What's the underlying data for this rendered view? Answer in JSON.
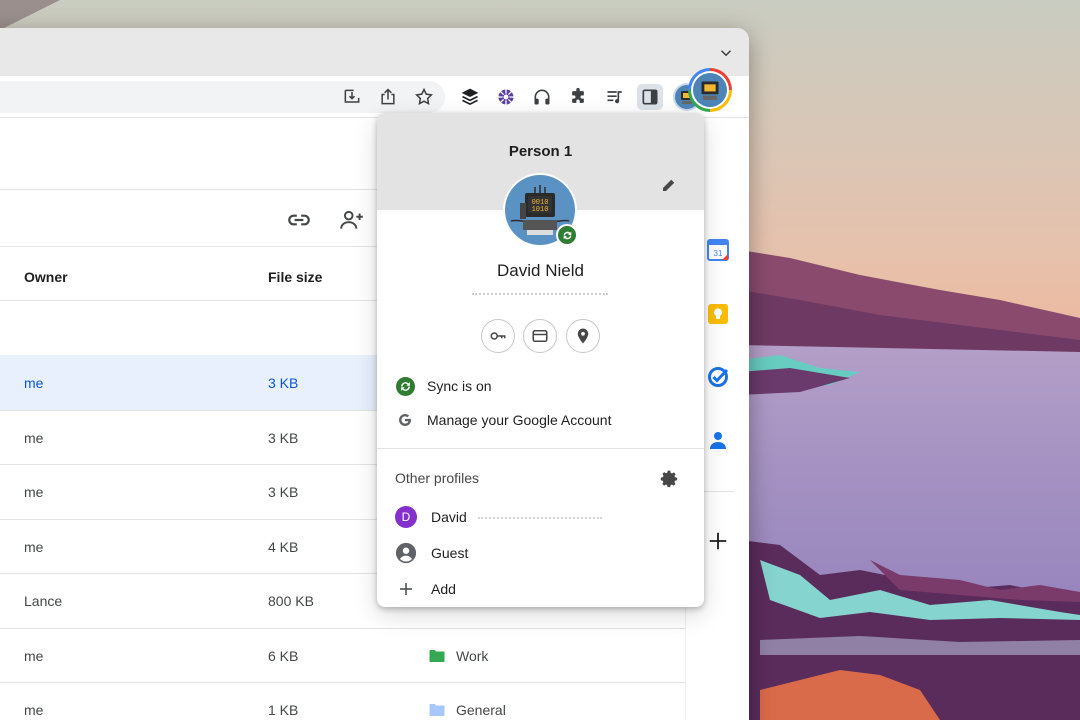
{
  "profile_menu": {
    "title": "Person 1",
    "user_name": "David Nield",
    "sync_label": "Sync is on",
    "manage_label": "Manage your Google Account",
    "other_profiles_label": "Other profiles",
    "profiles": [
      {
        "initial": "D",
        "name": "David"
      },
      {
        "name": "Guest"
      }
    ],
    "add_label": "Add"
  },
  "drive": {
    "columns": {
      "owner": "Owner",
      "file_size": "File size"
    },
    "rows": [
      {
        "owner": "me",
        "size": "3 KB",
        "location": "",
        "selected": true
      },
      {
        "owner": "me",
        "size": "3 KB",
        "location": ""
      },
      {
        "owner": "me",
        "size": "3 KB",
        "location": ""
      },
      {
        "owner": "me",
        "size": "4 KB",
        "location": ""
      },
      {
        "owner": "Lance",
        "size": "800 KB",
        "location": ""
      },
      {
        "owner": "me",
        "size": "6 KB",
        "location": "Work",
        "folder_color": "#34a853"
      },
      {
        "owner": "me",
        "size": "1 KB",
        "location": "General",
        "folder_color": "#a8c7fa"
      }
    ]
  },
  "rail": {
    "calendar_day": "31"
  },
  "colors": {
    "accent": "#0b57d0",
    "selected_row": "#e8f0fe",
    "sync_green": "#2e7d32",
    "menu_header": "#e3e3e3",
    "profile_avatar": "#8430ce"
  },
  "icons": {
    "toolbar": [
      "install-icon",
      "share-icon",
      "bookmark-star-icon",
      "buffer-extension-icon",
      "extension-flower-icon",
      "headphones-extension-icon",
      "extensions-puzzle-icon",
      "reading-list-icon",
      "side-panel-icon",
      "profile-avatar",
      "more-vert-icon"
    ],
    "quick_actions": [
      "key-icon",
      "credit-card-icon",
      "location-pin-icon"
    ]
  }
}
